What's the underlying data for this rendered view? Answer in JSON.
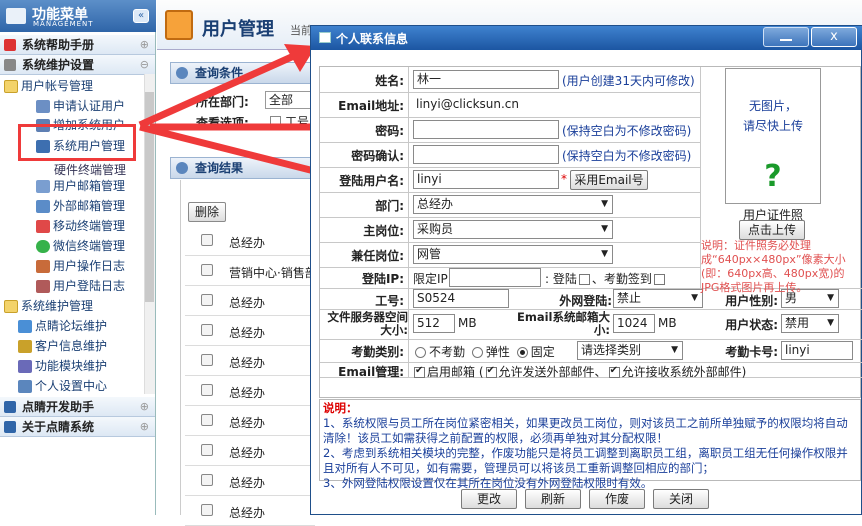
{
  "sidebar": {
    "title": "功能菜单",
    "subtitle": "MANAGEMENT",
    "collapse_icon": "double-chevron-left-icon",
    "sections": [
      {
        "label": "系统帮助手册",
        "toggle": "⊕"
      },
      {
        "label": "系统维护设置",
        "toggle": "⊖"
      },
      {
        "label": "点睛开发助手",
        "toggle": "⊕"
      },
      {
        "label": "关于点睛系统",
        "toggle": "⊕"
      }
    ],
    "tree": [
      "用户帐号管理",
      "申请认证用户",
      "增加系统用户",
      "系统用户管理",
      "硬件终端管理",
      "用户邮箱管理",
      "外部邮箱管理",
      "移动终端管理",
      "微信终端管理",
      "用户操作日志",
      "用户登陆日志",
      "系统维护管理",
      "点睛论坛维护",
      "客户信息维护",
      "功能模块维护",
      "个人设置中心"
    ]
  },
  "topbar": {
    "title": "用户管理",
    "current": "当前"
  },
  "query": {
    "header": "查询条件",
    "dept_label": "所在部门:",
    "dept_value": "全部",
    "options_label": "查看选项:",
    "options_value": "工号"
  },
  "results": {
    "header": "查询结果",
    "delete_label": "删除",
    "rows": [
      "总经办",
      "营销中心·销售部",
      "总经办",
      "总经办",
      "总经办",
      "总经办",
      "总经办",
      "总经办",
      "总经办",
      "总经办",
      "总经办",
      "总经办",
      "总经办",
      "总经办",
      "总经办",
      "总经办"
    ]
  },
  "dialog": {
    "title": "个人联系信息",
    "close_label": "x",
    "name_label": "姓名:",
    "name_value": "林一",
    "name_hint": "(用户创建31天内可修改)",
    "email_label": "Email地址:",
    "email_value": "linyi@clicksun.cn",
    "password_label": "密码:",
    "password_value": "",
    "password_hint": "(保持空白为不修改密码)",
    "confirm_label": "密码确认:",
    "confirm_value": "",
    "confirm_hint": "(保持空白为不修改密码)",
    "login_label": "登陆用户名:",
    "login_value": "linyi",
    "login_required": "*",
    "use_email_btn": "采用Email号",
    "dept_label": "部门:",
    "dept_value": "总经办",
    "post_label": "主岗位:",
    "post_value": "采购员",
    "side_post_label": "兼任岗位:",
    "side_post_value": "网管",
    "ip_label": "登陆IP:",
    "ip_limit_text": "限定IP",
    "ip_value": "",
    "ip_colon": ":",
    "ip_login_text": "登陆",
    "ip_checkin_text": "、考勤签到",
    "empno_label": "工号:",
    "empno_value": "S0524",
    "extlogin_label": "外网登陆:",
    "extlogin_value": "禁止",
    "gender_label": "用户性别:",
    "gender_value": "男",
    "filespace_label": "文件服务器空间大小:",
    "filespace_value": "512",
    "filespace_unit": "MB",
    "mailsize_label": "Email系统邮箱大小:",
    "mailsize_value": "1024",
    "mailsize_unit": "MB",
    "status_label": "用户状态:",
    "status_value": "禁用",
    "attend_label": "考勤类别:",
    "attend_opts": [
      "不考勤",
      "弹性",
      "固定"
    ],
    "attend_select": "请选择类别",
    "card_label": "考勤卡号:",
    "card_value": "linyi",
    "email_mgmt_label": "Email管理:",
    "email_mgmt_opts": [
      "启用邮箱",
      "允许发送外部邮件",
      "允许接收系统外部邮件"
    ],
    "email_mgmt_paren_open": "(",
    "email_mgmt_sep": "、",
    "email_mgmt_paren_close": ")",
    "photo_text1": "无图片，",
    "photo_text2": "请尽快上传",
    "photo_question": "?",
    "photo_caption": "用户证件照",
    "upload_btn": "点击上传",
    "photo_note": "说明：证件照务必处理成“640px×480px”像素大小(即：640px高、480px宽)的JPG格式图片再上传。",
    "note_title": "说明：",
    "note_lines": [
      "1、系统权限与员工所在岗位紧密相关，如果更改员工岗位，则对该员工之前所单独赋予的权限均将自动清除！该员工如需获得之前配置的权限，必须再单独对其分配权限！",
      "2、考虑到系统相关模块的完整，作废功能只是将员工调整到离职员工组，离职员工组无任何操作权限并且对所有人不可见，如有需要，管理员可以将该员工重新调整回相应的部门；",
      "3、外网登陆权限设置仅在其所在岗位没有外网登陆权限时有效。"
    ],
    "buttons": [
      "更改",
      "刷新",
      "作废",
      "关闭"
    ]
  },
  "colors": {
    "accent": "#1c56a2",
    "arrow": "#ef3a3a",
    "hint": "#1a3f9a",
    "warning": "#d00000",
    "highlight": "#ef3a3a"
  }
}
